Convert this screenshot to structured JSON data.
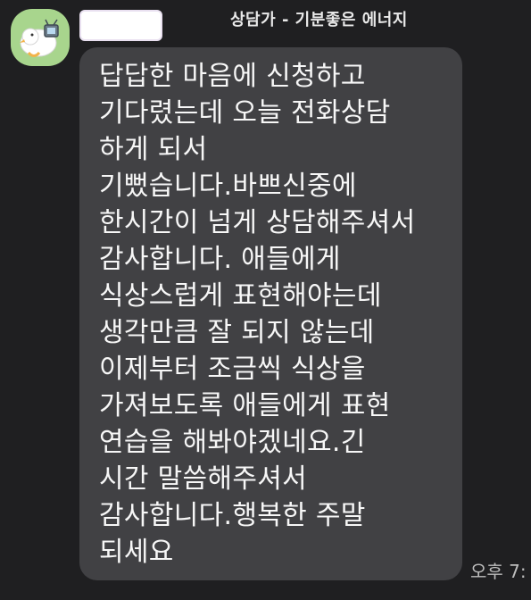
{
  "chat": {
    "title": "상담가 - 기분좋은 에너지",
    "timestamp": "오후 7:"
  },
  "message": {
    "lines": [
      "답답한 마음에 신청하고",
      "기다렸는데 오늘 전화상담",
      "하게 되서",
      "기뻤습니다.바쁘신중에",
      "한시간이 넘게 상담해주셔서",
      "감사합니다. 애들에게",
      "식상스럽게 표현해야는데",
      "생각만큼 잘 되지 않는데",
      "이제부터 조금씩 식상을",
      "가져보도록 애들에게 표현",
      "연습을 해봐야겠네요.긴",
      "시간 말씀해주셔서",
      "감사합니다.행복한 주말",
      "되세요"
    ]
  }
}
